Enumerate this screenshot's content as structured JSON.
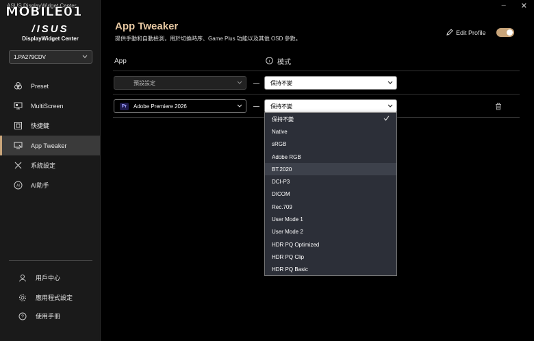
{
  "window": {
    "title": "ASUS DisplayWidget Center",
    "watermark": "MOBILE01"
  },
  "brand": {
    "logo": "/ISUS",
    "name": "DisplayWidget Center"
  },
  "monitor": {
    "selected": "1.PA279CDV"
  },
  "sidebar": {
    "items": [
      {
        "label": "Preset",
        "icon": "palette-icon"
      },
      {
        "label": "MultiScreen",
        "icon": "multiscreen-icon"
      },
      {
        "label": "快捷鍵",
        "icon": "shortcut-icon"
      },
      {
        "label": "App Tweaker",
        "icon": "app-tweaker-icon",
        "active": true
      },
      {
        "label": "系統設定",
        "icon": "tools-icon"
      },
      {
        "label": "AI助手",
        "icon": "ai-icon"
      }
    ],
    "bottom": [
      {
        "label": "用戶中心",
        "icon": "user-icon"
      },
      {
        "label": "應用程式設定",
        "icon": "gear-icon"
      },
      {
        "label": "使用手冊",
        "icon": "help-icon"
      }
    ]
  },
  "page": {
    "title": "App Tweaker",
    "description": "提供手動和自動檢測，用於切換時序、Game Plus 功能以及其他 OSD 參數。",
    "edit_profile": "Edit Profile",
    "toggle_on": true
  },
  "table": {
    "col_app": "App",
    "col_mode": "模式",
    "rows": [
      {
        "app": "預設設定",
        "mode": "保持不變",
        "disabled": true
      },
      {
        "app": "Adobe Premiere 2026",
        "app_badge": "Pr",
        "mode": "保持不變"
      }
    ]
  },
  "dropdown": {
    "options": [
      "保持不變",
      "Native",
      "sRGB",
      "Adobe RGB",
      "BT.2020",
      "DCI-P3",
      "DICOM",
      "Rec.709",
      "User Mode 1",
      "User Mode 2",
      "HDR PQ Optimized",
      "HDR PQ Clip",
      "HDR PQ Basic"
    ],
    "selected": "保持不變",
    "hovered": "BT.2020"
  },
  "colors": {
    "accent": "#c9a57a",
    "sidebar_bg": "#1a1a1a",
    "dropdown_bg": "#2c2f38"
  }
}
